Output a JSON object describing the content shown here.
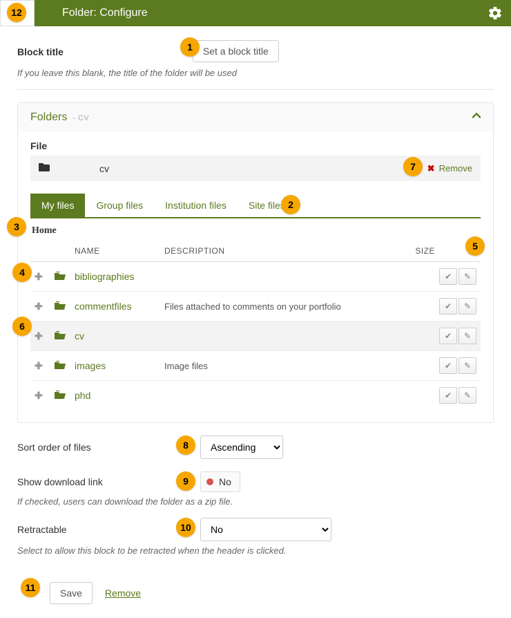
{
  "header": {
    "title": "Folder: Configure"
  },
  "block_title": {
    "label": "Block title",
    "button": "Set a block title",
    "help": "If you leave this blank, the title of the folder will be used"
  },
  "panel": {
    "title": "Folders",
    "subtitle": "- CV",
    "file_label": "File",
    "selected_file": "cv",
    "remove_label": "Remove"
  },
  "tabs": [
    "My files",
    "Group files",
    "Institution files",
    "Site files"
  ],
  "breadcrumb": "Home",
  "columns": {
    "name": "NAME",
    "description": "DESCRIPTION",
    "size": "SIZE"
  },
  "rows": [
    {
      "name": "bibliographies",
      "desc": ""
    },
    {
      "name": "commentfiles",
      "desc": "Files attached to comments on your portfolio"
    },
    {
      "name": "cv",
      "desc": ""
    },
    {
      "name": "images",
      "desc": "Image files"
    },
    {
      "name": "phd",
      "desc": ""
    }
  ],
  "sort": {
    "label": "Sort order of files",
    "value": "Ascending"
  },
  "download": {
    "label": "Show download link",
    "value": "No",
    "help": "If checked, users can download the folder as a zip file."
  },
  "retract": {
    "label": "Retractable",
    "value": "No",
    "help": "Select to allow this block to be retracted when the header is clicked."
  },
  "footer": {
    "save": "Save",
    "remove": "Remove"
  },
  "callouts": {
    "c1": "1",
    "c2": "2",
    "c3": "3",
    "c4": "4",
    "c5": "5",
    "c6": "6",
    "c7": "7",
    "c8": "8",
    "c9": "9",
    "c10": "10",
    "c11": "11",
    "c12": "12"
  }
}
